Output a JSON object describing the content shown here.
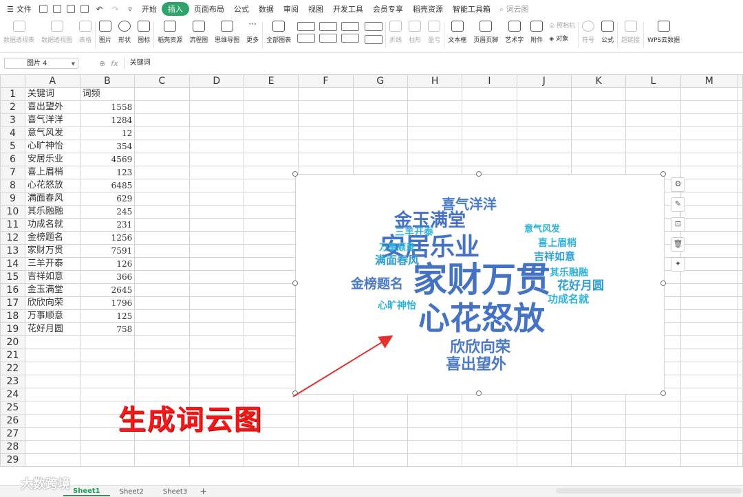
{
  "menu": {
    "file": "文件",
    "tabs": [
      "开始",
      "插入",
      "页面布局",
      "公式",
      "数据",
      "审阅",
      "视图",
      "开发工具",
      "会员专享",
      "稻壳资源",
      "智能工具箱"
    ],
    "active_tab": "插入",
    "search_placeholder": "词云图"
  },
  "ribbon": {
    "pivot_table": "数据透视表",
    "pivot_chart": "数据透视图",
    "table": "表格",
    "picture": "图片",
    "shape": "形状",
    "icon": "图标",
    "docer": "稻壳资源",
    "flowchart": "流程图",
    "mindmap": "思维导图",
    "more": "更多",
    "all_charts": "全部图表",
    "sparkline_line": "折线",
    "sparkline_column": "柱形",
    "sparkline_winloss": "盈亏",
    "textbox": "文本框",
    "header_footer": "页眉页脚",
    "wordart": "艺术字",
    "attachment": "附件",
    "camera": "照相机",
    "object": "对象",
    "symbol": "符号",
    "formula": "公式",
    "hyperlink": "超链接",
    "wps_cloud": "WPS云数据"
  },
  "formula_bar": {
    "name_box": "图片 4",
    "fx": "fx",
    "content": "关键词"
  },
  "columns": [
    "A",
    "B",
    "C",
    "D",
    "E",
    "F",
    "G",
    "H",
    "I",
    "J",
    "K",
    "L",
    "M"
  ],
  "header_row": [
    "关键词",
    "词频"
  ],
  "rows": [
    [
      "喜出望外",
      "1558"
    ],
    [
      "喜气洋洋",
      "1284"
    ],
    [
      "意气风发",
      "12"
    ],
    [
      "心旷神怡",
      "354"
    ],
    [
      "安居乐业",
      "4569"
    ],
    [
      "喜上眉梢",
      "123"
    ],
    [
      "心花怒放",
      "6485"
    ],
    [
      "满面春风",
      "629"
    ],
    [
      "其乐融融",
      "245"
    ],
    [
      "功成名就",
      "231"
    ],
    [
      "金榜题名",
      "1256"
    ],
    [
      "家财万贯",
      "7591"
    ],
    [
      "三羊开泰",
      "126"
    ],
    [
      "吉祥如意",
      "366"
    ],
    [
      "金玉满堂",
      "2645"
    ],
    [
      "欣欣向荣",
      "1796"
    ],
    [
      "万事顺意",
      "125"
    ],
    [
      "花好月圆",
      "758"
    ]
  ],
  "total_rows": 29,
  "wordcloud": [
    {
      "text": "家财万贯",
      "weight": 7591,
      "color": "#4472c4"
    },
    {
      "text": "心花怒放",
      "weight": 6485,
      "color": "#4472c4"
    },
    {
      "text": "安居乐业",
      "weight": 4569,
      "color": "#4472c4"
    },
    {
      "text": "金玉满堂",
      "weight": 2645,
      "color": "#4472c4"
    },
    {
      "text": "欣欣向荣",
      "weight": 1796,
      "color": "#4a7ac6"
    },
    {
      "text": "喜出望外",
      "weight": 1558,
      "color": "#4a7ac6"
    },
    {
      "text": "喜气洋洋",
      "weight": 1284,
      "color": "#4a7ac6"
    },
    {
      "text": "金榜题名",
      "weight": 1256,
      "color": "#4a7ac6"
    },
    {
      "text": "花好月圆",
      "weight": 758,
      "color": "#2fa0d4"
    },
    {
      "text": "满面春风",
      "weight": 629,
      "color": "#2fa0d4"
    },
    {
      "text": "吉祥如意",
      "weight": 366,
      "color": "#2fa0d4"
    },
    {
      "text": "心旷神怡",
      "weight": 354,
      "color": "#2fb3d8"
    },
    {
      "text": "其乐融融",
      "weight": 245,
      "color": "#2fb3d8"
    },
    {
      "text": "功成名就",
      "weight": 231,
      "color": "#2fb3d8"
    },
    {
      "text": "三羊开泰",
      "weight": 126,
      "color": "#2fb3d8"
    },
    {
      "text": "万事顺意",
      "weight": 125,
      "color": "#2fb3d8"
    },
    {
      "text": "喜上眉梢",
      "weight": 123,
      "color": "#2fb3d8"
    },
    {
      "text": "意气风发",
      "weight": 12,
      "color": "#2fb3d8"
    }
  ],
  "caption": "生成词云图",
  "caption_color": "#f41818",
  "sheet_tabs": [
    "Sheet1",
    "Sheet2",
    "Sheet3"
  ],
  "active_sheet": "Sheet1",
  "watermark": "大数跨境",
  "accent": "#2ea36a"
}
